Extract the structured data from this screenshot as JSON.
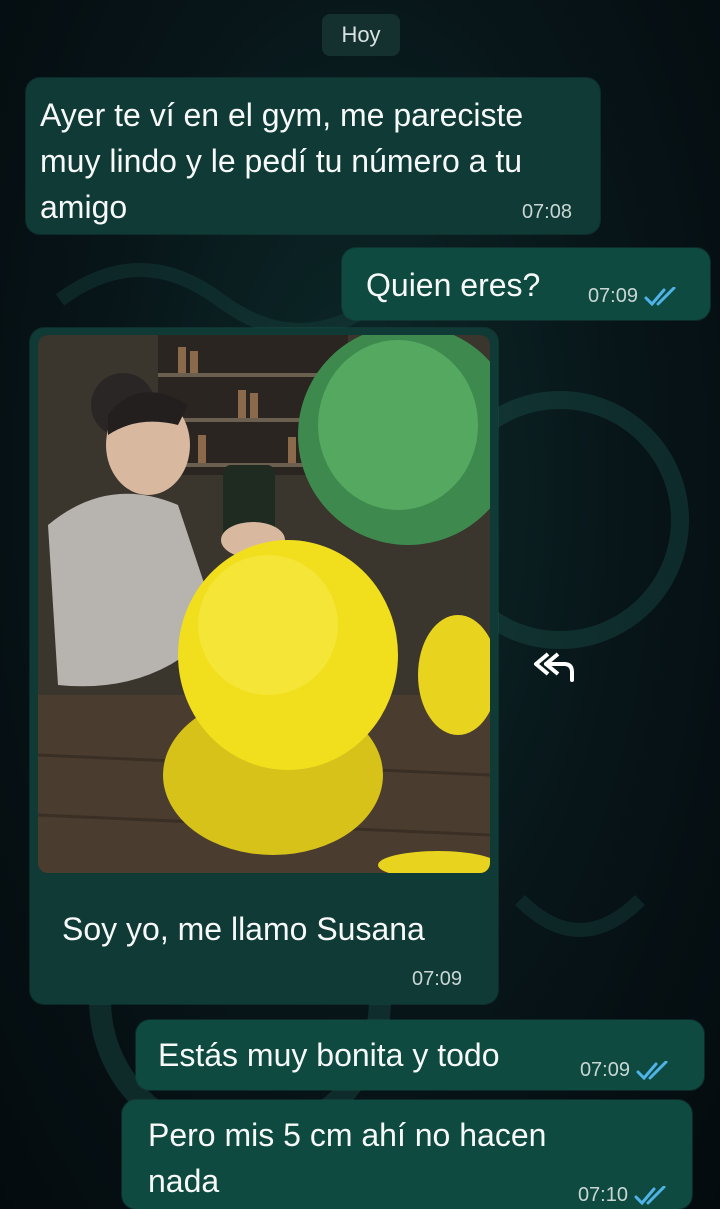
{
  "chat": {
    "date_label": "Hoy",
    "messages": [
      {
        "direction": "incoming",
        "text": "Ayer te ví en el gym, me pareciste muy lindo y le pedí tu número a tu amigo",
        "time": "07:08"
      },
      {
        "direction": "outgoing",
        "text": "Quien eres?",
        "time": "07:09",
        "status": "read"
      },
      {
        "direction": "incoming",
        "type": "image",
        "caption": "Soy yo, me llamo Susana",
        "time": "07:09"
      },
      {
        "direction": "outgoing",
        "text": "Estás muy bonita y todo",
        "time": "07:09",
        "status": "read"
      },
      {
        "direction": "outgoing",
        "text": "Pero mis 5 cm ahí no hacen nada",
        "time": "07:10",
        "status": "read"
      }
    ]
  },
  "icons": {
    "read_receipt": "double-check-icon",
    "forward": "forward-icon"
  },
  "colors": {
    "incoming_bubble": "#0f3a36",
    "outgoing_bubble": "#0e4a40",
    "read_check": "#4fb3e8"
  }
}
